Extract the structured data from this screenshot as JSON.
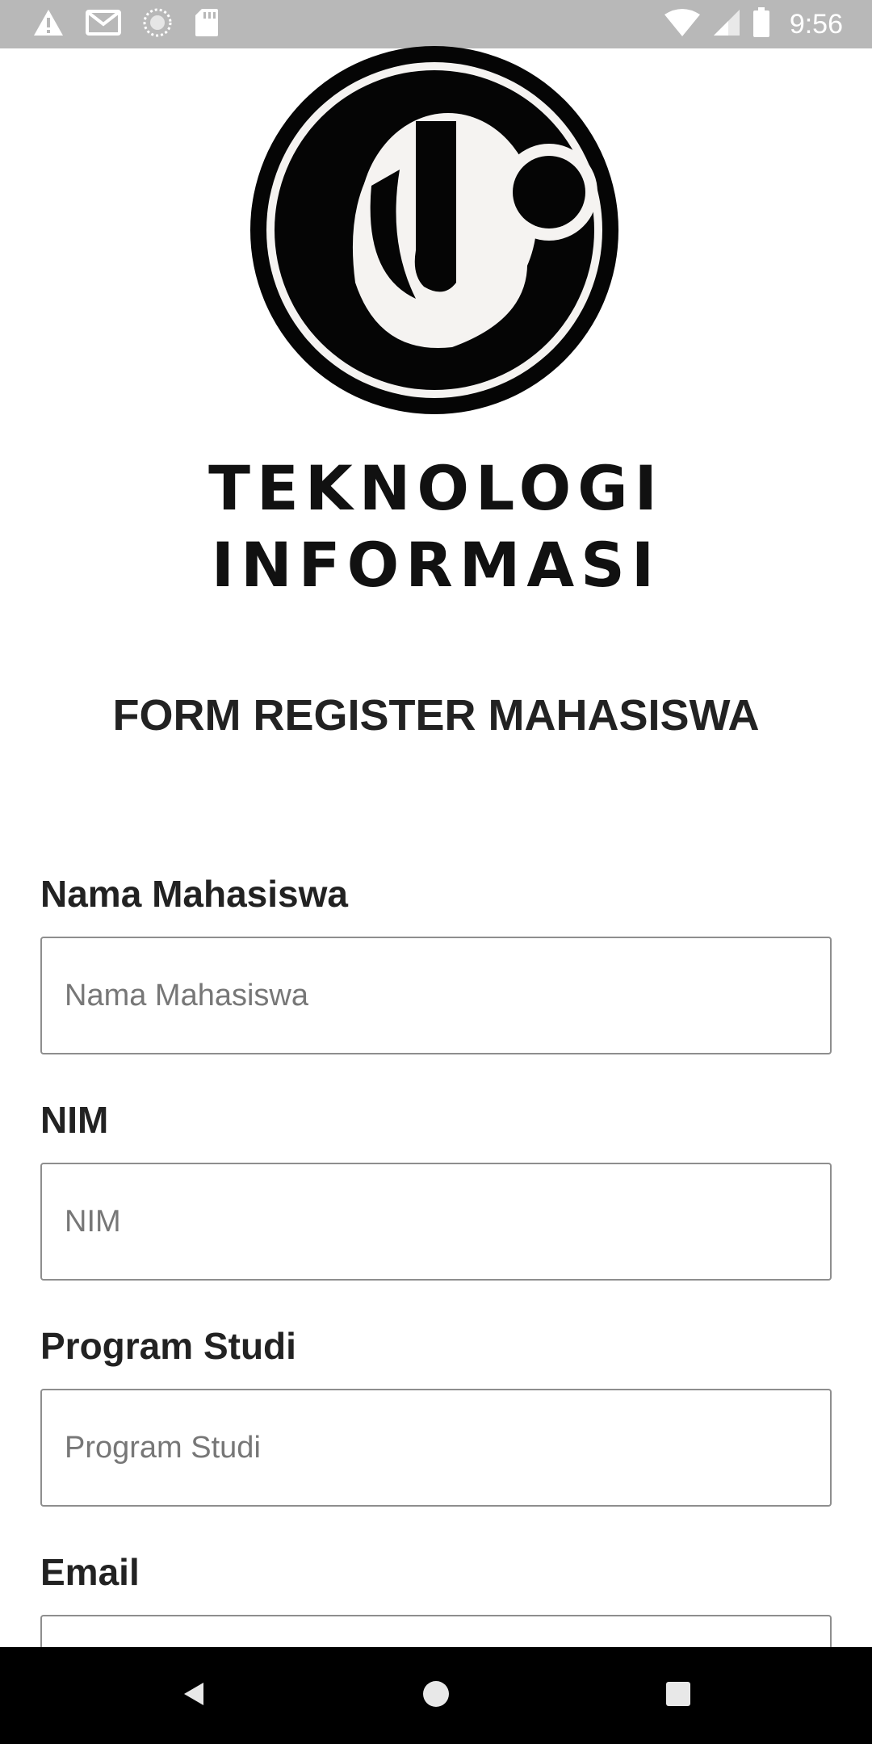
{
  "status_bar": {
    "time": "9:56",
    "icons": [
      "warning-icon",
      "gmail-icon",
      "sync-icon",
      "sd-card-icon",
      "wifi-icon",
      "signal-icon",
      "battery-icon"
    ]
  },
  "logo": {
    "line1": "TEKNOLOGI",
    "line2": "INFORMASI"
  },
  "form": {
    "title": "FORM REGISTER MAHASISWA",
    "fields": [
      {
        "label": "Nama Mahasiswa",
        "placeholder": "Nama Mahasiswa",
        "value": ""
      },
      {
        "label": "NIM",
        "placeholder": "NIM",
        "value": ""
      },
      {
        "label": "Program Studi",
        "placeholder": "Program Studi",
        "value": ""
      },
      {
        "label": "Email",
        "placeholder": "",
        "value": ""
      }
    ]
  },
  "nav_bar": {
    "buttons": [
      "back-icon",
      "home-icon",
      "recents-icon"
    ]
  },
  "colors": {
    "status_bar": "#b8b8b8",
    "nav_bar": "#000000",
    "input_border": "#8e8e8e",
    "placeholder": "#777777",
    "text": "#222222"
  }
}
